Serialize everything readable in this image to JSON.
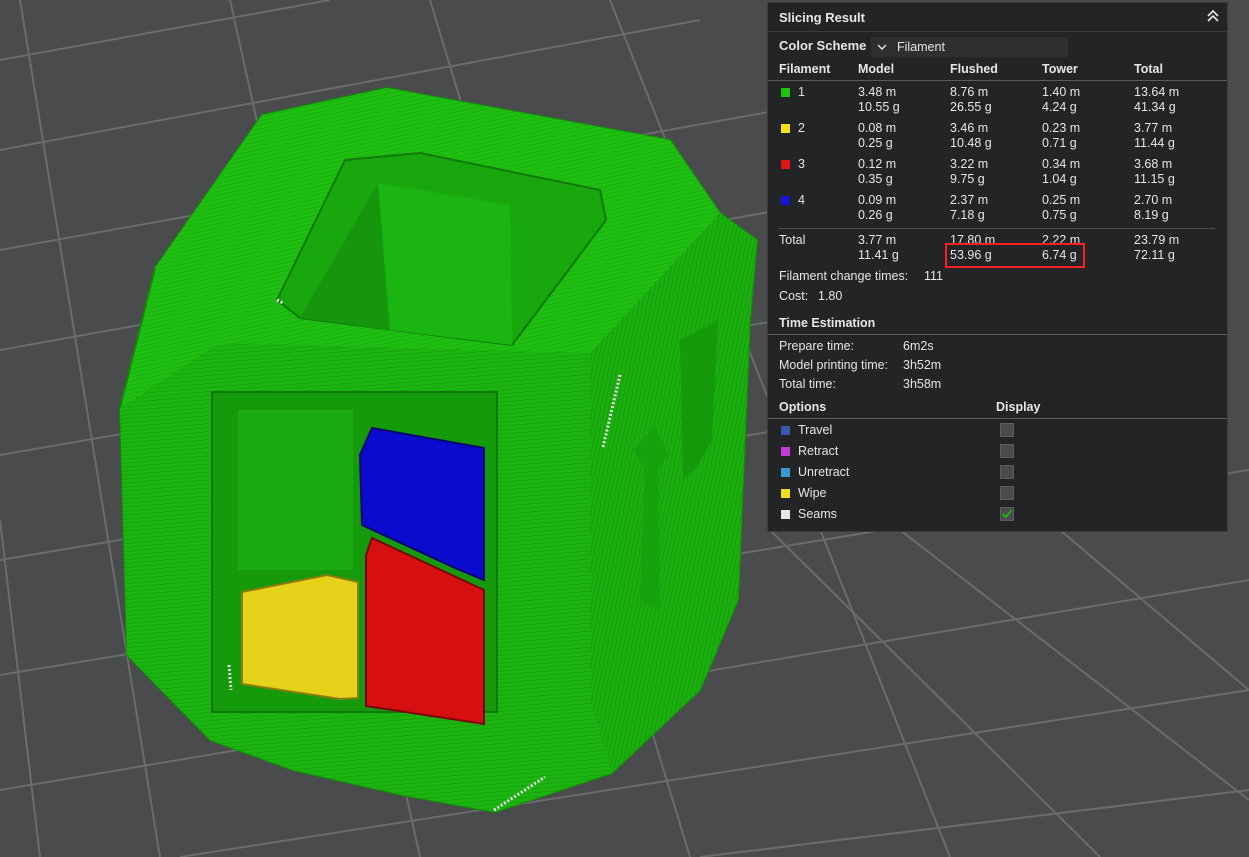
{
  "panel": {
    "title": "Slicing Result",
    "color_scheme_label": "Color Scheme",
    "color_scheme_value": "Filament",
    "columns": [
      "Filament",
      "Model",
      "Flushed",
      "Tower",
      "Total"
    ],
    "filaments": [
      {
        "id": "1",
        "color": "#22c414",
        "model_m": "3.48 m",
        "model_g": "10.55 g",
        "flushed_m": "8.76 m",
        "flushed_g": "26.55 g",
        "tower_m": "1.40 m",
        "tower_g": "4.24 g",
        "total_m": "13.64 m",
        "total_g": "41.34 g"
      },
      {
        "id": "2",
        "color": "#f2e11a",
        "model_m": "0.08 m",
        "model_g": "0.25 g",
        "flushed_m": "3.46 m",
        "flushed_g": "10.48 g",
        "tower_m": "0.23 m",
        "tower_g": "0.71 g",
        "total_m": "3.77 m",
        "total_g": "11.44 g"
      },
      {
        "id": "3",
        "color": "#e01414",
        "model_m": "0.12 m",
        "model_g": "0.35 g",
        "flushed_m": "3.22 m",
        "flushed_g": "9.75 g",
        "tower_m": "0.34 m",
        "tower_g": "1.04 g",
        "total_m": "3.68 m",
        "total_g": "11.15 g"
      },
      {
        "id": "4",
        "color": "#1414d8",
        "model_m": "0.09 m",
        "model_g": "0.26 g",
        "flushed_m": "2.37 m",
        "flushed_g": "7.18 g",
        "tower_m": "0.25 m",
        "tower_g": "0.75 g",
        "total_m": "2.70 m",
        "total_g": "8.19 g"
      }
    ],
    "total": {
      "label": "Total",
      "model_m": "3.77 m",
      "model_g": "11.41 g",
      "flushed_m": "17.80 m",
      "flushed_g": "53.96 g",
      "tower_m": "2.22 m",
      "tower_g": "6.74 g",
      "total_m": "23.79 m",
      "total_g": "72.11 g"
    },
    "filament_change_label": "Filament change times:",
    "filament_change_value": "111",
    "cost_label": "Cost:",
    "cost_value": "1.80",
    "time_title": "Time Estimation",
    "prepare_label": "Prepare time:",
    "prepare_value": "6m2s",
    "model_print_label": "Model printing time:",
    "model_print_value": "3h52m",
    "total_time_label": "Total time:",
    "total_time_value": "3h58m",
    "options_title": "Options",
    "display_title": "Display",
    "options": [
      {
        "label": "Travel",
        "color": "#3a57b0",
        "checked": false
      },
      {
        "label": "Retract",
        "color": "#c43ad6",
        "checked": false
      },
      {
        "label": "Unretract",
        "color": "#3a9ad6",
        "checked": false
      },
      {
        "label": "Wipe",
        "color": "#f2e11a",
        "checked": false
      },
      {
        "label": "Seams",
        "color": "#e6e6e6",
        "checked": true
      }
    ]
  },
  "colors": {
    "background": "#4a4b4d",
    "grid": "#6a6b6d",
    "model_green": "#1fbf12",
    "highlight_red": "#ff1f1f"
  }
}
